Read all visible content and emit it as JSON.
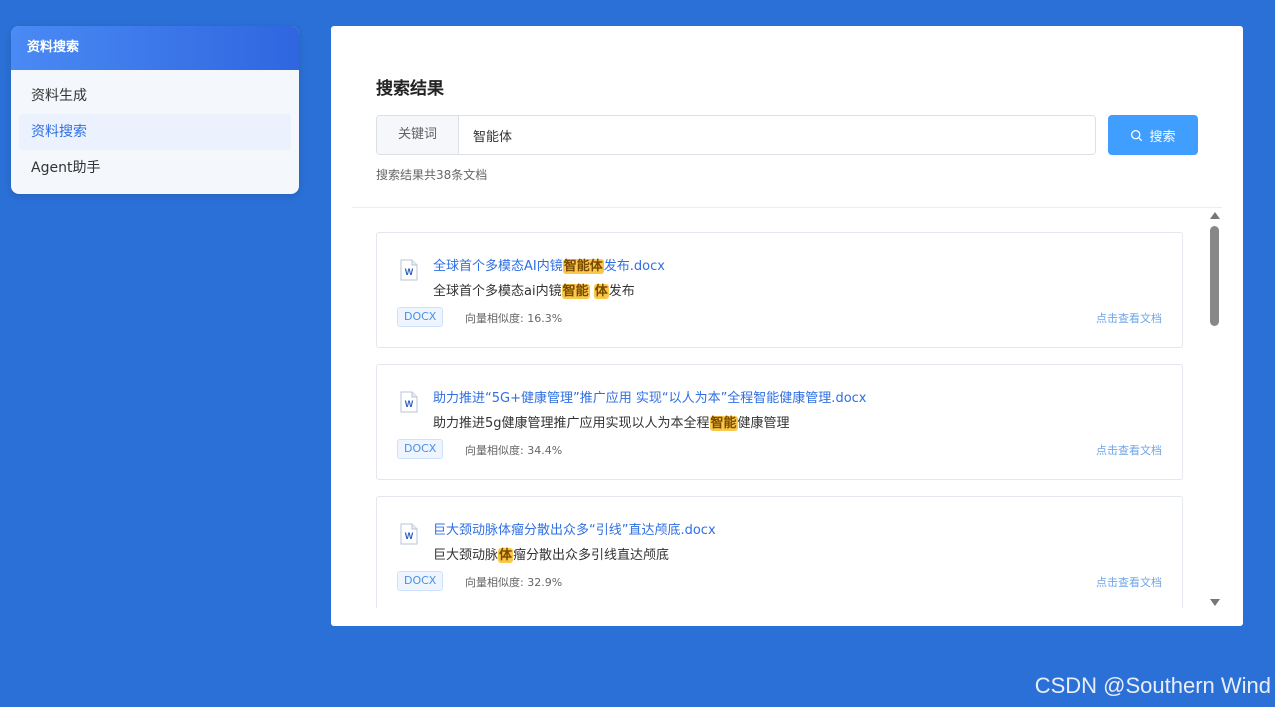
{
  "sidebar": {
    "header": "资料搜索",
    "items": [
      {
        "label": "资料生成",
        "active": false
      },
      {
        "label": "资料搜索",
        "active": true
      },
      {
        "label": "Agent助手",
        "active": false
      }
    ]
  },
  "main": {
    "title": "搜索结果",
    "search": {
      "prefix": "关键词",
      "value": "智能体",
      "button_label": "搜索"
    },
    "result_count": "搜索结果共38条文档",
    "results": [
      {
        "title_parts": [
          {
            "text": "全球首个多模态AI内镜",
            "hl": false
          },
          {
            "text": "智能体",
            "hl": true
          },
          {
            "text": "发布.docx",
            "hl": false
          }
        ],
        "snippet_parts": [
          {
            "text": "全球首个多模态ai内镜",
            "hl": false
          },
          {
            "text": "智能",
            "hl": true
          },
          {
            "text": " ",
            "hl": false
          },
          {
            "text": "体",
            "hl": true
          },
          {
            "text": "发布",
            "hl": false
          }
        ],
        "tag": "DOCX",
        "similarity": "向量相似度: 16.3%",
        "link": "点击查看文档"
      },
      {
        "title_parts": [
          {
            "text": "助力推进“5G+健康管理”推广应用 实现“以人为本”全程智能健康管理.docx",
            "hl": false
          }
        ],
        "snippet_parts": [
          {
            "text": "助力推进5g健康管理推广应用实现以人为本全程",
            "hl": false
          },
          {
            "text": "智能",
            "hl": true
          },
          {
            "text": "健康管理",
            "hl": false
          }
        ],
        "tag": "DOCX",
        "similarity": "向量相似度: 34.4%",
        "link": "点击查看文档"
      },
      {
        "title_parts": [
          {
            "text": "巨大颈动脉体瘤分散出众多“引线”直达颅底.docx",
            "hl": false
          }
        ],
        "snippet_parts": [
          {
            "text": "巨大颈动脉",
            "hl": false
          },
          {
            "text": "体",
            "hl": true
          },
          {
            "text": "瘤分散出众多引线直达颅底",
            "hl": false
          }
        ],
        "tag": "DOCX",
        "similarity": "向量相似度: 32.9%",
        "link": "点击查看文档"
      }
    ]
  },
  "watermark": "CSDN @Southern Wind",
  "colors": {
    "background": "#2a70d6",
    "accent": "#409eff",
    "highlight": "#f9c84a",
    "link": "#2f6fe4"
  },
  "icons": {
    "search_button": "search-icon",
    "doc": "word-doc-icon"
  }
}
